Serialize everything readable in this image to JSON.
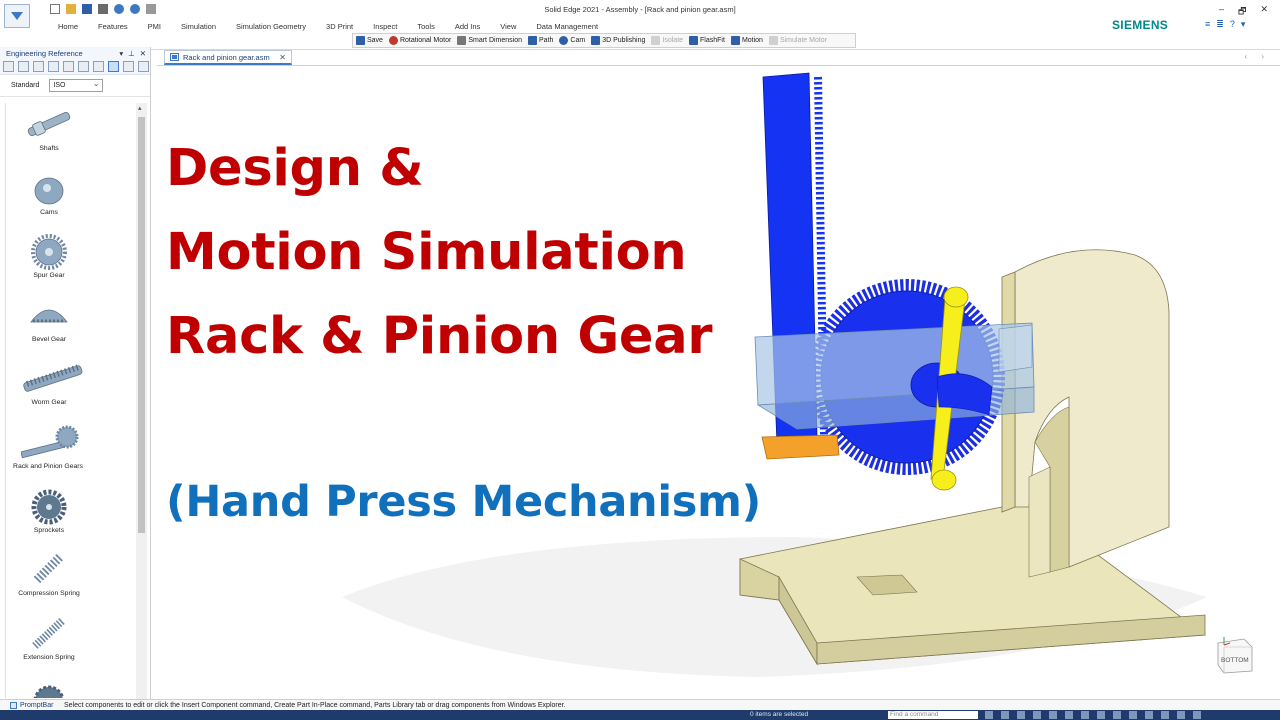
{
  "window": {
    "title": "Solid Edge 2021 - Assembly - [Rack and pinion gear.asm]",
    "brand": "SIEMENS",
    "controls": [
      "–",
      "🗗",
      "✕"
    ]
  },
  "menu_tabs": [
    "Home",
    "Features",
    "PMI",
    "Simulation",
    "Simulation Geometry",
    "3D Print",
    "Inspect",
    "Tools",
    "Add Ins",
    "View",
    "Data Management"
  ],
  "command_bar": [
    {
      "label": "Save",
      "icon": "save-icon",
      "color": "#2f5fa8",
      "enabled": true
    },
    {
      "label": "Rotational Motor",
      "icon": "rotational-motor-icon",
      "color": "#c0392b",
      "enabled": true
    },
    {
      "label": "Smart Dimension",
      "icon": "smart-dimension-icon",
      "color": "#555555",
      "enabled": true
    },
    {
      "label": "Path",
      "icon": "path-icon",
      "color": "#2f5fa8",
      "enabled": true
    },
    {
      "label": "Cam",
      "icon": "cam-icon",
      "color": "#2f5fa8",
      "enabled": true
    },
    {
      "label": "3D Publishing",
      "icon": "publishing-icon",
      "color": "#2f5fa8",
      "enabled": true
    },
    {
      "label": "Isolate",
      "icon": "isolate-icon",
      "color": "#bbbbbb",
      "enabled": false
    },
    {
      "label": "FlashFit",
      "icon": "flashfit-icon",
      "color": "#2f5fa8",
      "enabled": true
    },
    {
      "label": "Motion",
      "icon": "motion-icon",
      "color": "#2f5fa8",
      "enabled": true
    },
    {
      "label": "Simulate Motor",
      "icon": "simulate-motor-icon",
      "color": "#bbbbbb",
      "enabled": false
    }
  ],
  "left_panel": {
    "title": "Engineering Reference",
    "header_controls": [
      "▾",
      "⊥",
      "✕"
    ],
    "standard_label": "Standard",
    "standard_value": "ISO",
    "items": [
      {
        "label": "Shafts",
        "icon": "shaft-icon"
      },
      {
        "label": "Cams",
        "icon": "cam-part-icon"
      },
      {
        "label": "Spur Gear",
        "icon": "spur-gear-icon"
      },
      {
        "label": "Bevel Gear",
        "icon": "bevel-gear-icon"
      },
      {
        "label": "Worm Gear",
        "icon": "worm-gear-icon"
      },
      {
        "label": "Rack and Pinion Gears",
        "icon": "rack-pinion-icon"
      },
      {
        "label": "Sprockets",
        "icon": "sprocket-icon"
      },
      {
        "label": "Compression Spring",
        "icon": "compression-spring-icon"
      },
      {
        "label": "Extension Spring",
        "icon": "extension-spring-icon"
      }
    ]
  },
  "document_tab": {
    "label": "Rack and pinion gear.asm",
    "nav": "‹ ›"
  },
  "viewport": {
    "headline": [
      "Design &",
      "Motion Simulation",
      "Rack & Pinion Gear"
    ],
    "subtitle": "(Hand Press Mechanism)",
    "headline_color": "#c00000",
    "subtitle_color": "#1170bb",
    "view_cube_label": "BOTTOM"
  },
  "status": {
    "prompt_label": "PromptBar",
    "prompt_text": "Select components to edit or click the Insert Component command, Create Part In-Place command, Parts Library tab or drag components from Windows Explorer.",
    "selection_count": "0 items are selected",
    "find_placeholder": "Find a command"
  }
}
